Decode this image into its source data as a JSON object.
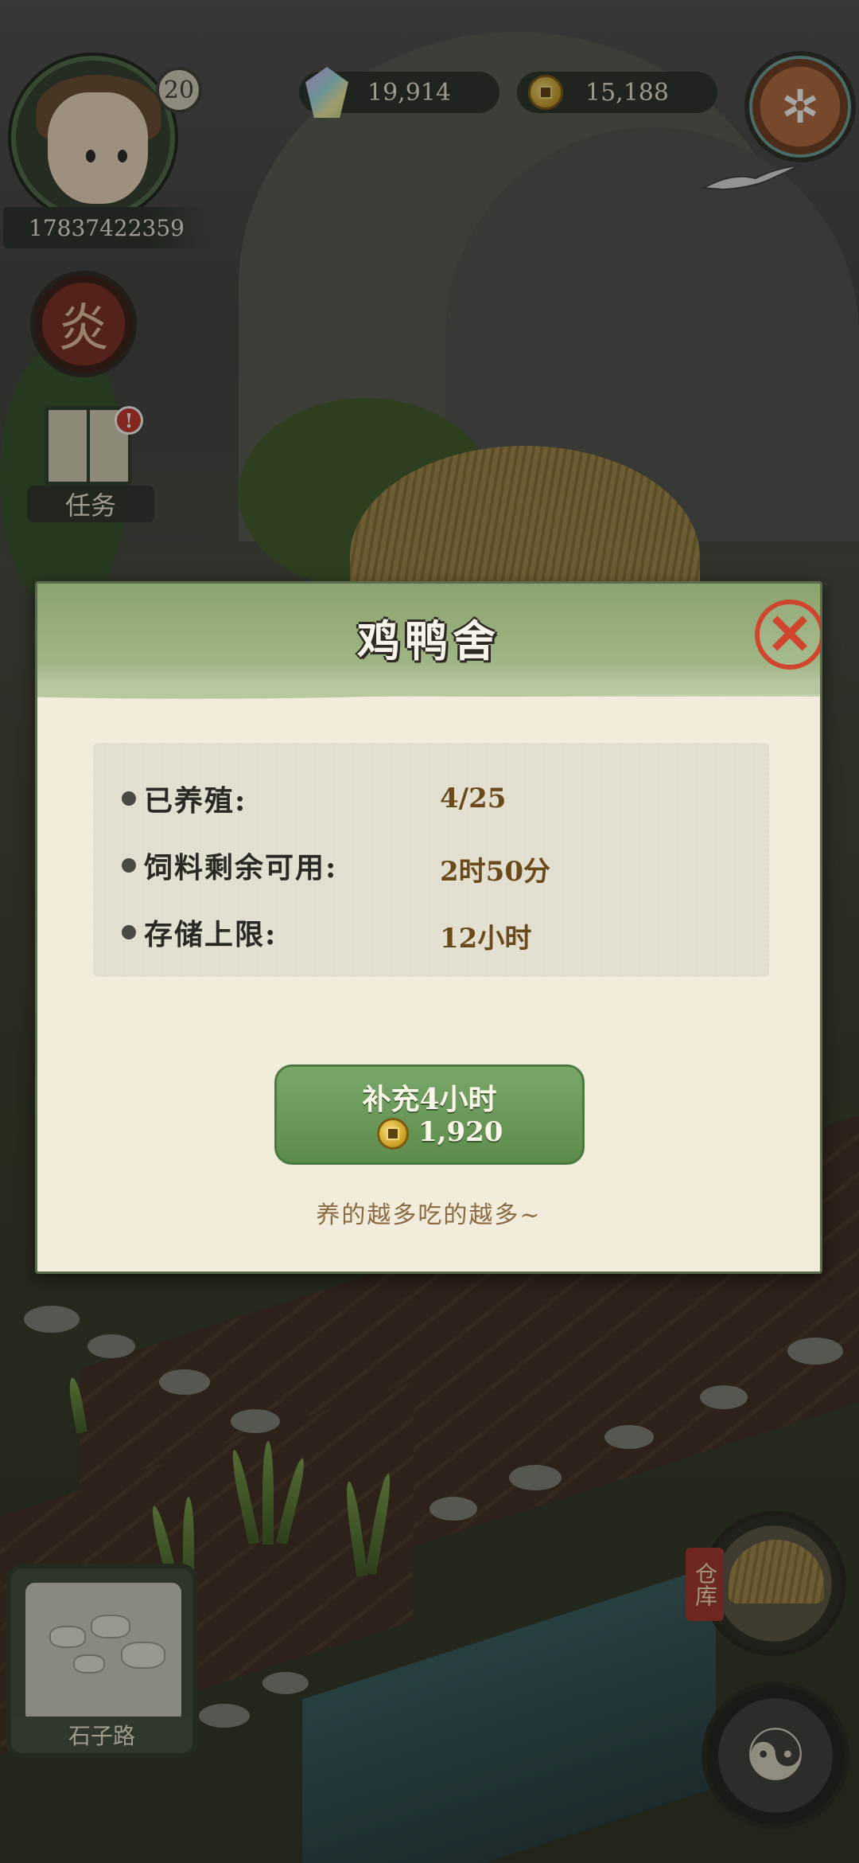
{
  "player": {
    "level": "20",
    "id": "17837422359"
  },
  "resources": {
    "gems": "19,914",
    "coins": "15,188"
  },
  "side_buttons": {
    "flame_glyph": "炎",
    "task_label": "任务",
    "alert_mark": "!"
  },
  "dialog": {
    "title": "鸡鸭舍",
    "close_glyph": "✕",
    "rows": [
      {
        "label": "已养殖:",
        "value": "4/25"
      },
      {
        "label": "饲料剩余可用:",
        "value": "2时50分"
      },
      {
        "label": "存储上限:",
        "value": "12小时"
      }
    ],
    "refill_button": {
      "label": "补充4小时",
      "cost": "1,920"
    },
    "hint": "养的越多吃的越多~"
  },
  "minimap": {
    "label": "石子路"
  },
  "storehouse": {
    "label": "仓库"
  },
  "icons": {
    "gem": "gem-icon",
    "coin": "coin-icon",
    "settings": "gear-icon",
    "flame": "flame-icon",
    "task": "scroll-icon",
    "close": "close-icon",
    "yinyang": "yinyang-icon"
  },
  "colors": {
    "close": "#d0452e",
    "button": "#6a9a5a",
    "alert": "#c9322b",
    "value_text": "#6a4a1a"
  }
}
